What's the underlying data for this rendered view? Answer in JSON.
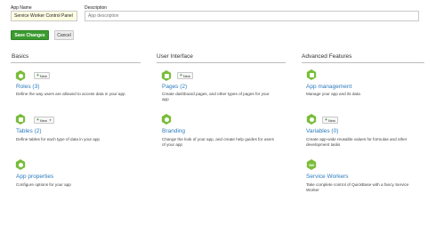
{
  "form": {
    "app_name_label": "App Name",
    "app_name_value": "Service Worker Control Panel",
    "description_label": "Description",
    "description_placeholder": "App description",
    "save_label": "Save Changes",
    "cancel_label": "Cancel"
  },
  "sections": {
    "basics": {
      "title": "Basics",
      "items": [
        {
          "title": "Roles (3)",
          "desc": "Define the way users are allowed to access data in your app",
          "icon": "roles-icon",
          "new_label": "New"
        },
        {
          "title": "Tables (2)",
          "desc": "Define tables for each type of data in your app",
          "icon": "tables-icon",
          "new_label": "New"
        },
        {
          "title": "App properties",
          "desc": "Configure options for your app",
          "icon": "app-properties-icon"
        }
      ]
    },
    "ui": {
      "title": "User Interface",
      "items": [
        {
          "title": "Pages (2)",
          "desc_1": "Create dashboard pages, and other types of pages for your",
          "desc_2": "app",
          "icon": "pages-icon",
          "new_label": "New"
        },
        {
          "title": "Branding",
          "desc_1": "Change the look of your app, and create help guides for users",
          "desc_2": "of your app",
          "icon": "branding-icon"
        }
      ]
    },
    "advanced": {
      "title": "Advanced Features",
      "items": [
        {
          "title": "App management",
          "desc": "Manage your app and its data",
          "icon": "app-management-icon"
        },
        {
          "title": "Variables (0)",
          "desc_1": "Create app-wide reusable values for formulas and other",
          "desc_2": "development tasks",
          "icon": "variables-icon",
          "new_label": "New"
        },
        {
          "title": "Service Workers",
          "desc_1": "Take complete control of QuickBase with a fancy Service",
          "desc_2": "Worker",
          "icon": "service-workers-icon",
          "icon_text": "SW"
        }
      ]
    }
  },
  "colors": {
    "accent_green": "#79bd3a",
    "button_green": "#3a9b2f",
    "link_blue": "#2b7bbd"
  }
}
